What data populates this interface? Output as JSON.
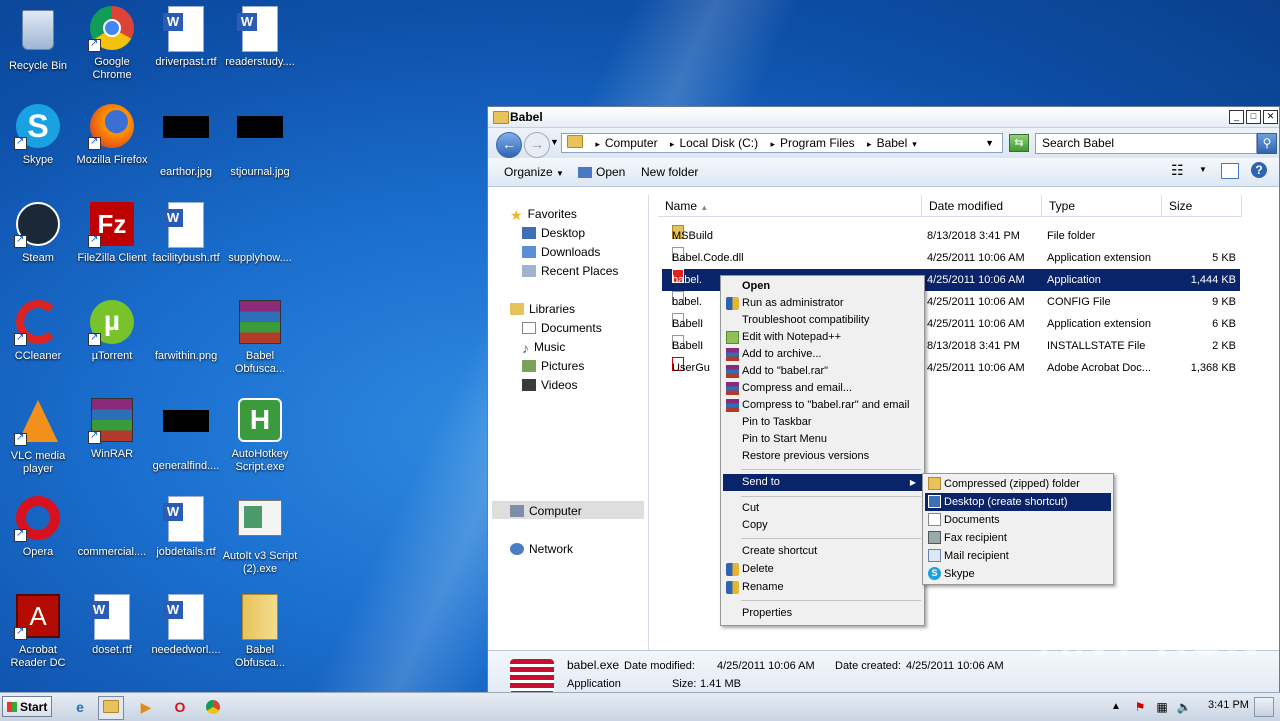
{
  "desktop": {
    "icons": [
      {
        "label": "Recycle Bin",
        "icon": "recycle-bin-icon"
      },
      {
        "label": "Google Chrome",
        "icon": "chrome-icon"
      },
      {
        "label": "driverpast.rtf",
        "icon": "word-doc-icon"
      },
      {
        "label": "readerstudy....",
        "icon": "word-doc-icon"
      },
      {
        "label": "Skype",
        "icon": "skype-icon"
      },
      {
        "label": "Mozilla Firefox",
        "icon": "firefox-icon"
      },
      {
        "label": "earthor.jpg",
        "icon": "image-icon"
      },
      {
        "label": "stjournal.jpg",
        "icon": "image-icon"
      },
      {
        "label": "Steam",
        "icon": "steam-icon"
      },
      {
        "label": "FileZilla Client",
        "icon": "filezilla-icon"
      },
      {
        "label": "facilitybush.rtf",
        "icon": "word-doc-icon"
      },
      {
        "label": "supplyhow....",
        "icon": "file-icon"
      },
      {
        "label": "CCleaner",
        "icon": "ccleaner-icon"
      },
      {
        "label": "µTorrent",
        "icon": "utorrent-icon"
      },
      {
        "label": "farwithin.png",
        "icon": "image-icon"
      },
      {
        "label": "Babel Obfusca...",
        "icon": "winrar-icon"
      },
      {
        "label": "VLC media player",
        "icon": "vlc-icon"
      },
      {
        "label": "WinRAR",
        "icon": "winrar-icon"
      },
      {
        "label": "generalfind....",
        "icon": "image-icon"
      },
      {
        "label": "AutoHotkey Script.exe",
        "icon": "autohotkey-icon"
      },
      {
        "label": "Opera",
        "icon": "opera-icon"
      },
      {
        "label": "commercial....",
        "icon": "file-icon"
      },
      {
        "label": "jobdetails.rtf",
        "icon": "word-doc-icon"
      },
      {
        "label": "AutoIt v3 Script (2).exe",
        "icon": "autoit-icon"
      },
      {
        "label": "Acrobat Reader DC",
        "icon": "acrobat-icon"
      },
      {
        "label": "doset.rtf",
        "icon": "word-doc-icon"
      },
      {
        "label": "neededworl....",
        "icon": "word-doc-icon"
      },
      {
        "label": "Babel Obfusca...",
        "icon": "folder-icon"
      }
    ]
  },
  "window": {
    "title": "Babel",
    "breadcrumb": [
      "Computer",
      "Local Disk (C:)",
      "Program Files",
      "Babel"
    ],
    "search_placeholder": "Search Babel",
    "toolbar": {
      "organize": "Organize",
      "open": "Open",
      "new_folder": "New folder"
    },
    "nav": {
      "favorites": "Favorites",
      "desktop": "Desktop",
      "downloads": "Downloads",
      "recent": "Recent Places",
      "libraries": "Libraries",
      "documents": "Documents",
      "music": "Music",
      "pictures": "Pictures",
      "videos": "Videos",
      "computer": "Computer",
      "network": "Network"
    },
    "columns": {
      "name": "Name",
      "date": "Date modified",
      "type": "Type",
      "size": "Size"
    },
    "files": [
      {
        "name": "MSBuild",
        "date": "8/13/2018 3:41 PM",
        "type": "File folder",
        "size": ""
      },
      {
        "name": "Babel.Code.dll",
        "date": "4/25/2011 10:06 AM",
        "type": "Application extension",
        "size": "5 KB"
      },
      {
        "name": "babel.",
        "date": "4/25/2011 10:06 AM",
        "type": "Application",
        "size": "1,444 KB"
      },
      {
        "name": "babel.",
        "date": "4/25/2011 10:06 AM",
        "type": "CONFIG File",
        "size": "9 KB"
      },
      {
        "name": "BabelI",
        "date": "4/25/2011 10:06 AM",
        "type": "Application extension",
        "size": "6 KB"
      },
      {
        "name": "BabelI",
        "date": "8/13/2018 3:41 PM",
        "type": "INSTALLSTATE File",
        "size": "2 KB"
      },
      {
        "name": "UserGu",
        "date": "4/25/2011 10:06 AM",
        "type": "Adobe Acrobat Doc...",
        "size": "1,368 KB"
      }
    ],
    "details": {
      "filename": "babel.exe",
      "modified_label": "Date modified:",
      "modified": "4/25/2011 10:06 AM",
      "created_label": "Date created:",
      "created": "4/25/2011 10:06 AM",
      "kind": "Application",
      "size_label": "Size:",
      "size": "1.41 MB"
    }
  },
  "context_menu": {
    "items": [
      "Open",
      "Run as administrator",
      "Troubleshoot compatibility",
      "Edit with Notepad++",
      "Add to archive...",
      "Add to \"babel.rar\"",
      "Compress and email...",
      "Compress to \"babel.rar\" and email",
      "Pin to Taskbar",
      "Pin to Start Menu",
      "Restore previous versions",
      "Send to",
      "Cut",
      "Copy",
      "Create shortcut",
      "Delete",
      "Rename",
      "Properties"
    ],
    "send_to": [
      "Compressed (zipped) folder",
      "Desktop (create shortcut)",
      "Documents",
      "Fax recipient",
      "Mail recipient",
      "Skype"
    ]
  },
  "taskbar": {
    "start": "Start",
    "clock": "3:41 PM"
  },
  "watermark": "ANY RUN",
  "colors": {
    "selection": "#0a246a",
    "menu_bg": "#f0f0f0",
    "desktop": "#1b6fcf"
  }
}
